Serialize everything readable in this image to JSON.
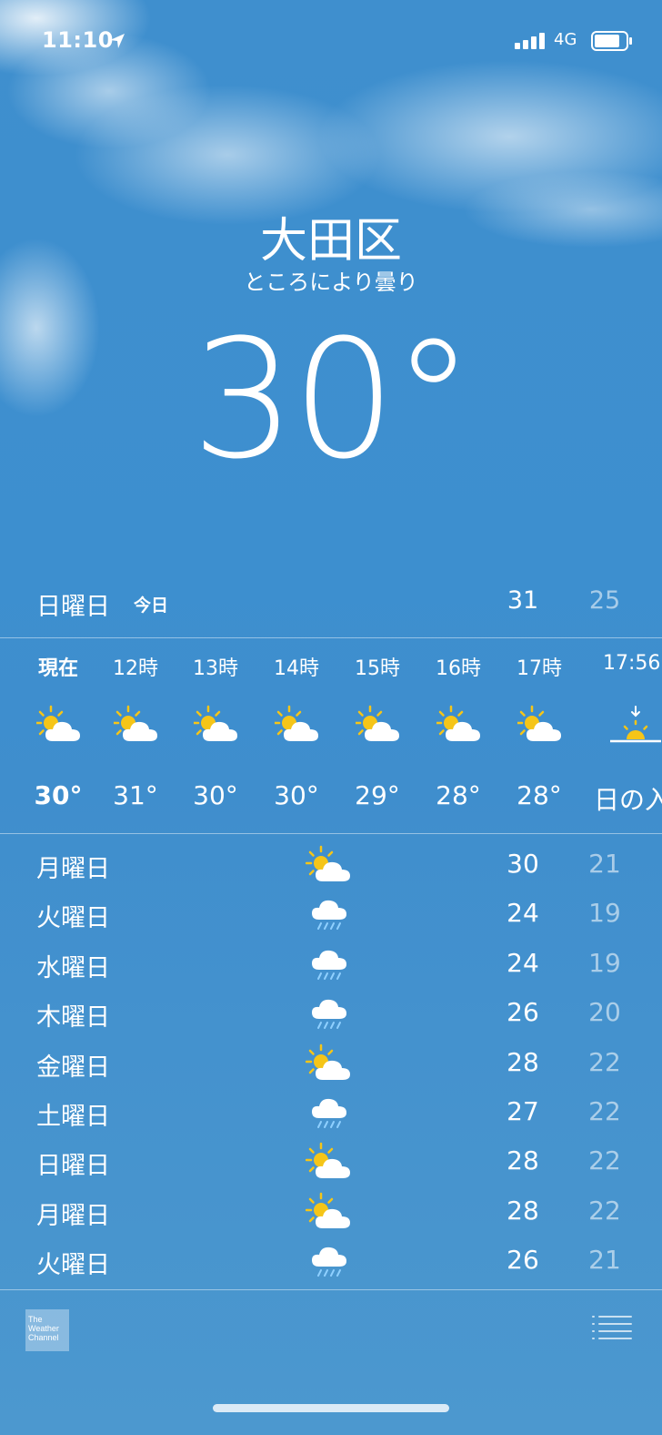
{
  "status_bar": {
    "time": "11:10",
    "network": "4G"
  },
  "location": {
    "city": "大田区",
    "condition": "ところにより曇り",
    "temperature": "30°"
  },
  "today": {
    "day": "日曜日",
    "label": "今日",
    "high": "31",
    "low": "25"
  },
  "hourly": [
    {
      "time": "現在",
      "icon": "partly-cloudy-icon",
      "temp": "30°"
    },
    {
      "time": "12時",
      "icon": "partly-cloudy-icon",
      "temp": "31°"
    },
    {
      "time": "13時",
      "icon": "partly-cloudy-icon",
      "temp": "30°"
    },
    {
      "time": "14時",
      "icon": "partly-cloudy-icon",
      "temp": "30°"
    },
    {
      "time": "15時",
      "icon": "partly-cloudy-icon",
      "temp": "29°"
    },
    {
      "time": "16時",
      "icon": "partly-cloudy-icon",
      "temp": "28°"
    },
    {
      "time": "17時",
      "icon": "partly-cloudy-icon",
      "temp": "28°"
    },
    {
      "time": "17:56",
      "icon": "sunset-icon",
      "temp": "日の入"
    }
  ],
  "daily": [
    {
      "day": "月曜日",
      "icon": "partly-cloudy-icon",
      "high": "30",
      "low": "21"
    },
    {
      "day": "火曜日",
      "icon": "rain-icon",
      "high": "24",
      "low": "19"
    },
    {
      "day": "水曜日",
      "icon": "rain-icon",
      "high": "24",
      "low": "19"
    },
    {
      "day": "木曜日",
      "icon": "rain-icon",
      "high": "26",
      "low": "20"
    },
    {
      "day": "金曜日",
      "icon": "partly-cloudy-icon",
      "high": "28",
      "low": "22"
    },
    {
      "day": "土曜日",
      "icon": "rain-icon",
      "high": "27",
      "low": "22"
    },
    {
      "day": "日曜日",
      "icon": "partly-cloudy-icon",
      "high": "28",
      "low": "22"
    },
    {
      "day": "月曜日",
      "icon": "partly-cloudy-icon",
      "high": "28",
      "low": "22"
    },
    {
      "day": "火曜日",
      "icon": "rain-icon",
      "high": "26",
      "low": "21"
    }
  ],
  "footer": {
    "logo_text": "The Weather Channel"
  },
  "colors": {
    "sky": "#3f8fce",
    "sun": "#f5c518",
    "low_temp": "rgba(255,255,255,0.55)"
  }
}
